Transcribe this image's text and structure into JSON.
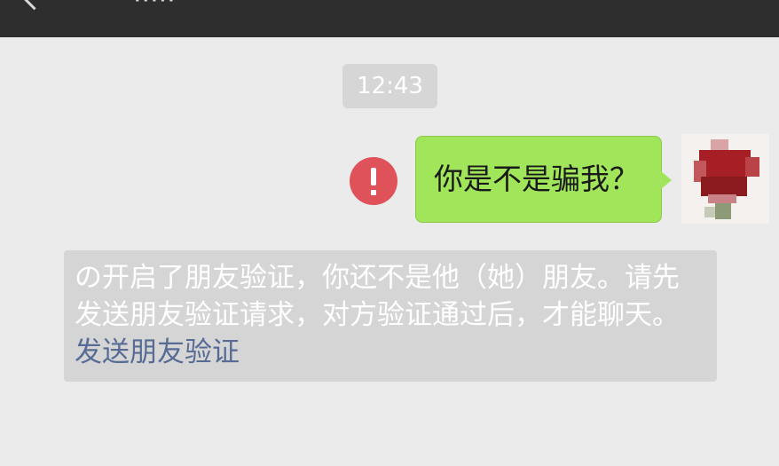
{
  "header": {
    "back_icon": "back-arrow-icon",
    "title": "·····"
  },
  "chat": {
    "timestamp": "12:43",
    "outgoing_message": {
      "text": "你是不是骗我？",
      "status_icon": "exclamation-circle-icon",
      "status_color": "#e0525a",
      "bubble_color": "#a0e55a"
    },
    "system_notice": {
      "line1": "の开启了朋友验证，你还不是他（她）朋友。",
      "line2": "请先发送朋友验证请求，对方验证通过后，才",
      "line3_prefix": "能聊天。",
      "link_text": "发送朋友验证",
      "link_color": "#576b95"
    }
  }
}
